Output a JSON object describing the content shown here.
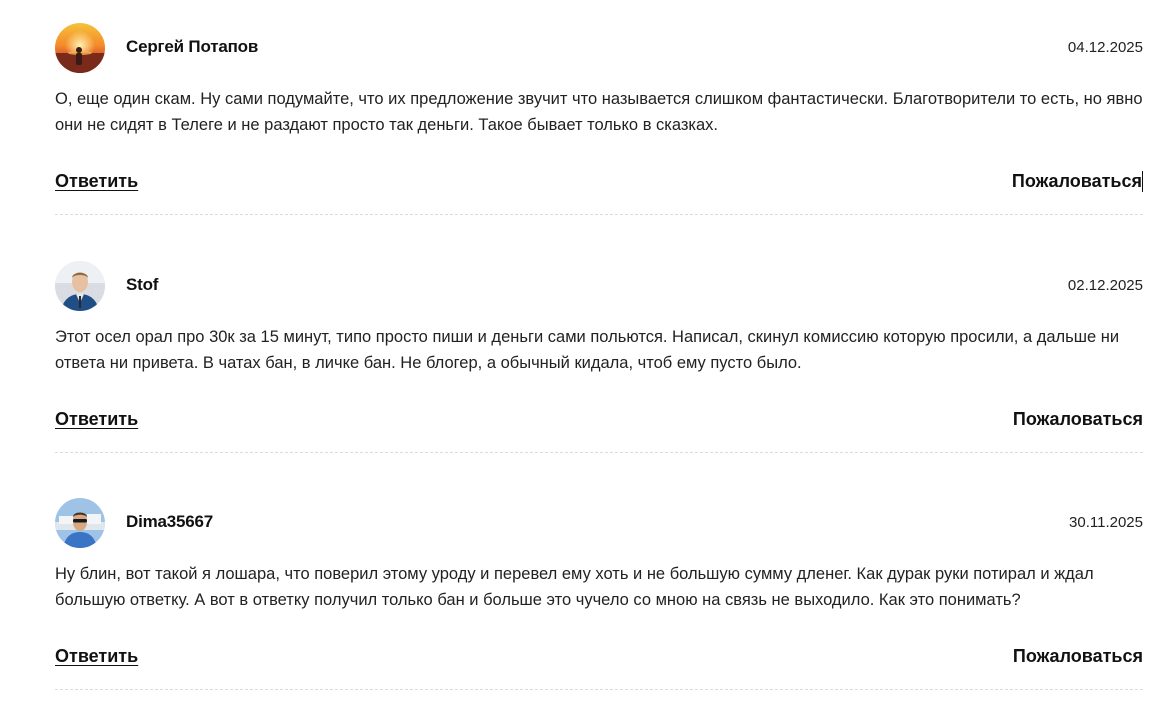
{
  "comments": [
    {
      "author": "Сергей Потапов",
      "date": "04.12.2025",
      "text": "О, еще один скам. Ну сами подумайте, что их предложение звучит что называется слишком фантастически. Благотворители то есть, но явно они не сидят в Телеге и не раздают просто так деньги. Такое бывает только в сказках.",
      "reply_label": "Ответить",
      "report_label": "Пожаловаться",
      "avatar_icon": "sunset-avatar"
    },
    {
      "author": "Stof",
      "date": "02.12.2025",
      "text": "Этот осел орал про 30к за 15 минут, типо просто пиши и деньги сами польются. Написал, скинул комиссию которую просили, а дальше ни ответа ни привета. В чатах бан, в личке бан. Не блогер, а обычный кидала, чтоб ему пусто было.",
      "reply_label": "Ответить",
      "report_label": "Пожаловаться",
      "avatar_icon": "man-in-suit-avatar"
    },
    {
      "author": "Dima35667",
      "date": "30.11.2025",
      "text": "Ну блин, вот такой я лошара, что поверил этому уроду и перевел ему хоть и не большую сумму дленег. Как дурак руки потирал и ждал большую ответку. А вот в ответку получил только бан и больше это чучело со мною на связь не выходило. Как это понимать?",
      "reply_label": "Ответить",
      "report_label": "Пожаловаться",
      "avatar_icon": "man-sunglasses-avatar"
    }
  ],
  "colors": {
    "text": "#222222",
    "divider": "#dcdcdc"
  }
}
